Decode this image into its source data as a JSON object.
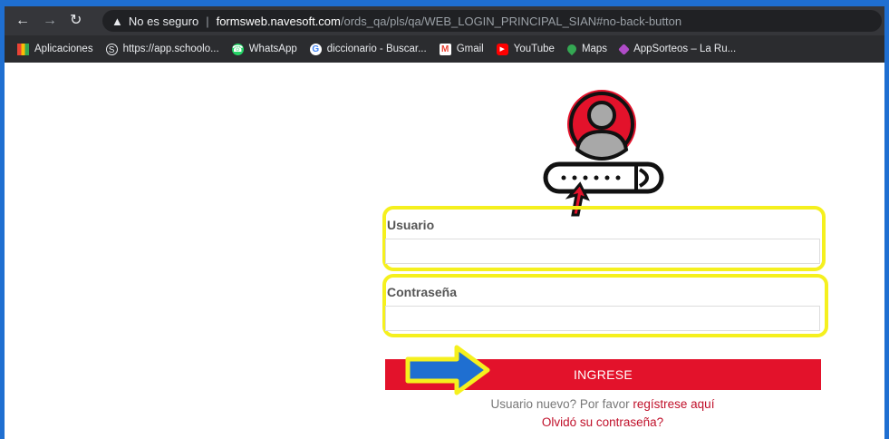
{
  "browser": {
    "security_label": "No es seguro",
    "separator": "|",
    "url_host": "formsweb.navesoft.com",
    "url_path": "/ords_qa/pls/qa/WEB_LOGIN_PRINCIPAL_SIAN#no-back-button",
    "bookmarks": [
      {
        "label": "Aplicaciones",
        "icon": "apps-grid-icon"
      },
      {
        "label": "https://app.schoolo...",
        "icon": "schoology-icon"
      },
      {
        "label": "WhatsApp",
        "icon": "whatsapp-icon"
      },
      {
        "label": "diccionario - Buscar...",
        "icon": "google-icon"
      },
      {
        "label": "Gmail",
        "icon": "gmail-icon"
      },
      {
        "label": "YouTube",
        "icon": "youtube-icon"
      },
      {
        "label": "Maps",
        "icon": "maps-icon"
      },
      {
        "label": "AppSorteos – La Ru...",
        "icon": "appsorteos-icon"
      }
    ]
  },
  "login": {
    "username_label": "Usuario",
    "username_value": "",
    "password_label": "Contraseña",
    "password_value": "",
    "submit_label": "INGRESE",
    "register_prefix": "Usuario nuevo? Por favor ",
    "register_link": "regístrese aquí",
    "forgot_link": "Olvidó su contraseña?"
  },
  "colors": {
    "frame": "#1f6fd1",
    "highlight": "#f5f01e",
    "button": "#e3122b",
    "link": "#c0102a"
  }
}
